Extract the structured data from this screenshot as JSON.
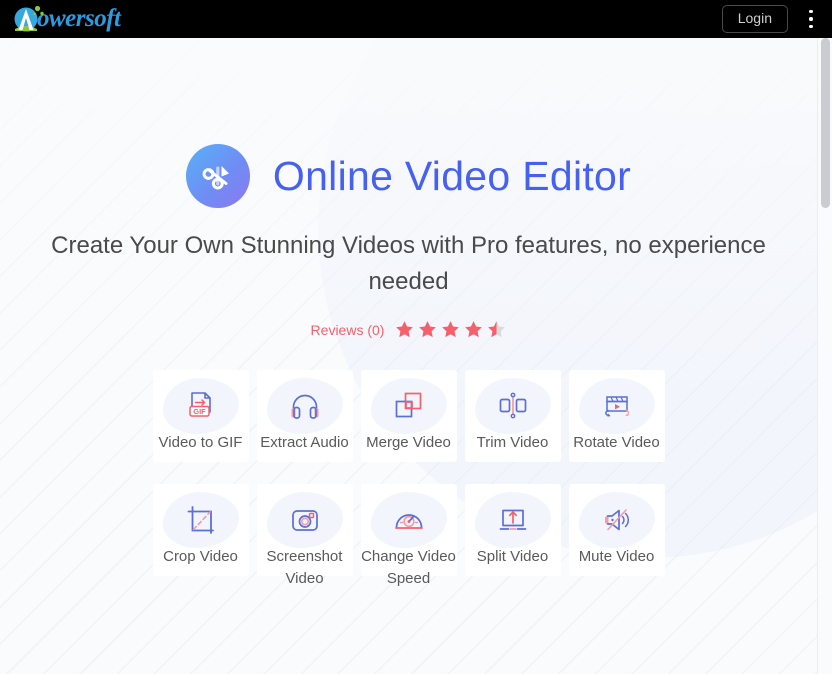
{
  "browser": {
    "logo_text": "powersoft",
    "logo_letter": "A",
    "login_label": "Login",
    "menu_icon": "kebab-menu-icon"
  },
  "hero": {
    "icon": "scissors-icon",
    "title": "Online Video Editor",
    "subtitle": "Create Your Own Stunning Videos with Pro features, no experience needed",
    "reviews_label": "Reviews (0)",
    "rating": 4.5,
    "stars_total": 5,
    "star_color": "#f4606c",
    "star_empty_color": "#d8dade"
  },
  "colors": {
    "title_blue": "#4661ef",
    "accent_red": "#f4606c",
    "icon_blue": "#5b6fd6",
    "icon_pink": "#f79aa3",
    "header_bg": "#000000",
    "page_bg": "#fafbfc",
    "card_bg": "#ffffff",
    "blob_bg": "#f3f5fd"
  },
  "tools": [
    {
      "id": "video-to-gif",
      "label": "Video to GIF",
      "icon": "gif-file-icon"
    },
    {
      "id": "extract-audio",
      "label": "Extract Audio",
      "icon": "headphones-icon"
    },
    {
      "id": "merge-video",
      "label": "Merge Video",
      "icon": "merge-squares-icon"
    },
    {
      "id": "trim-video",
      "label": "Trim Video",
      "icon": "trim-icon"
    },
    {
      "id": "rotate-video",
      "label": "Rotate Video",
      "icon": "clapperboard-rotate-icon"
    },
    {
      "id": "crop-video",
      "label": "Crop Video",
      "icon": "crop-icon"
    },
    {
      "id": "screenshot-video",
      "label": "Screenshot Video",
      "icon": "camera-icon"
    },
    {
      "id": "change-video-speed",
      "label": "Change Video Speed",
      "icon": "speedometer-icon"
    },
    {
      "id": "split-video",
      "label": "Split Video",
      "icon": "split-upload-icon"
    },
    {
      "id": "mute-video",
      "label": "Mute Video",
      "icon": "speaker-mute-icon"
    }
  ]
}
